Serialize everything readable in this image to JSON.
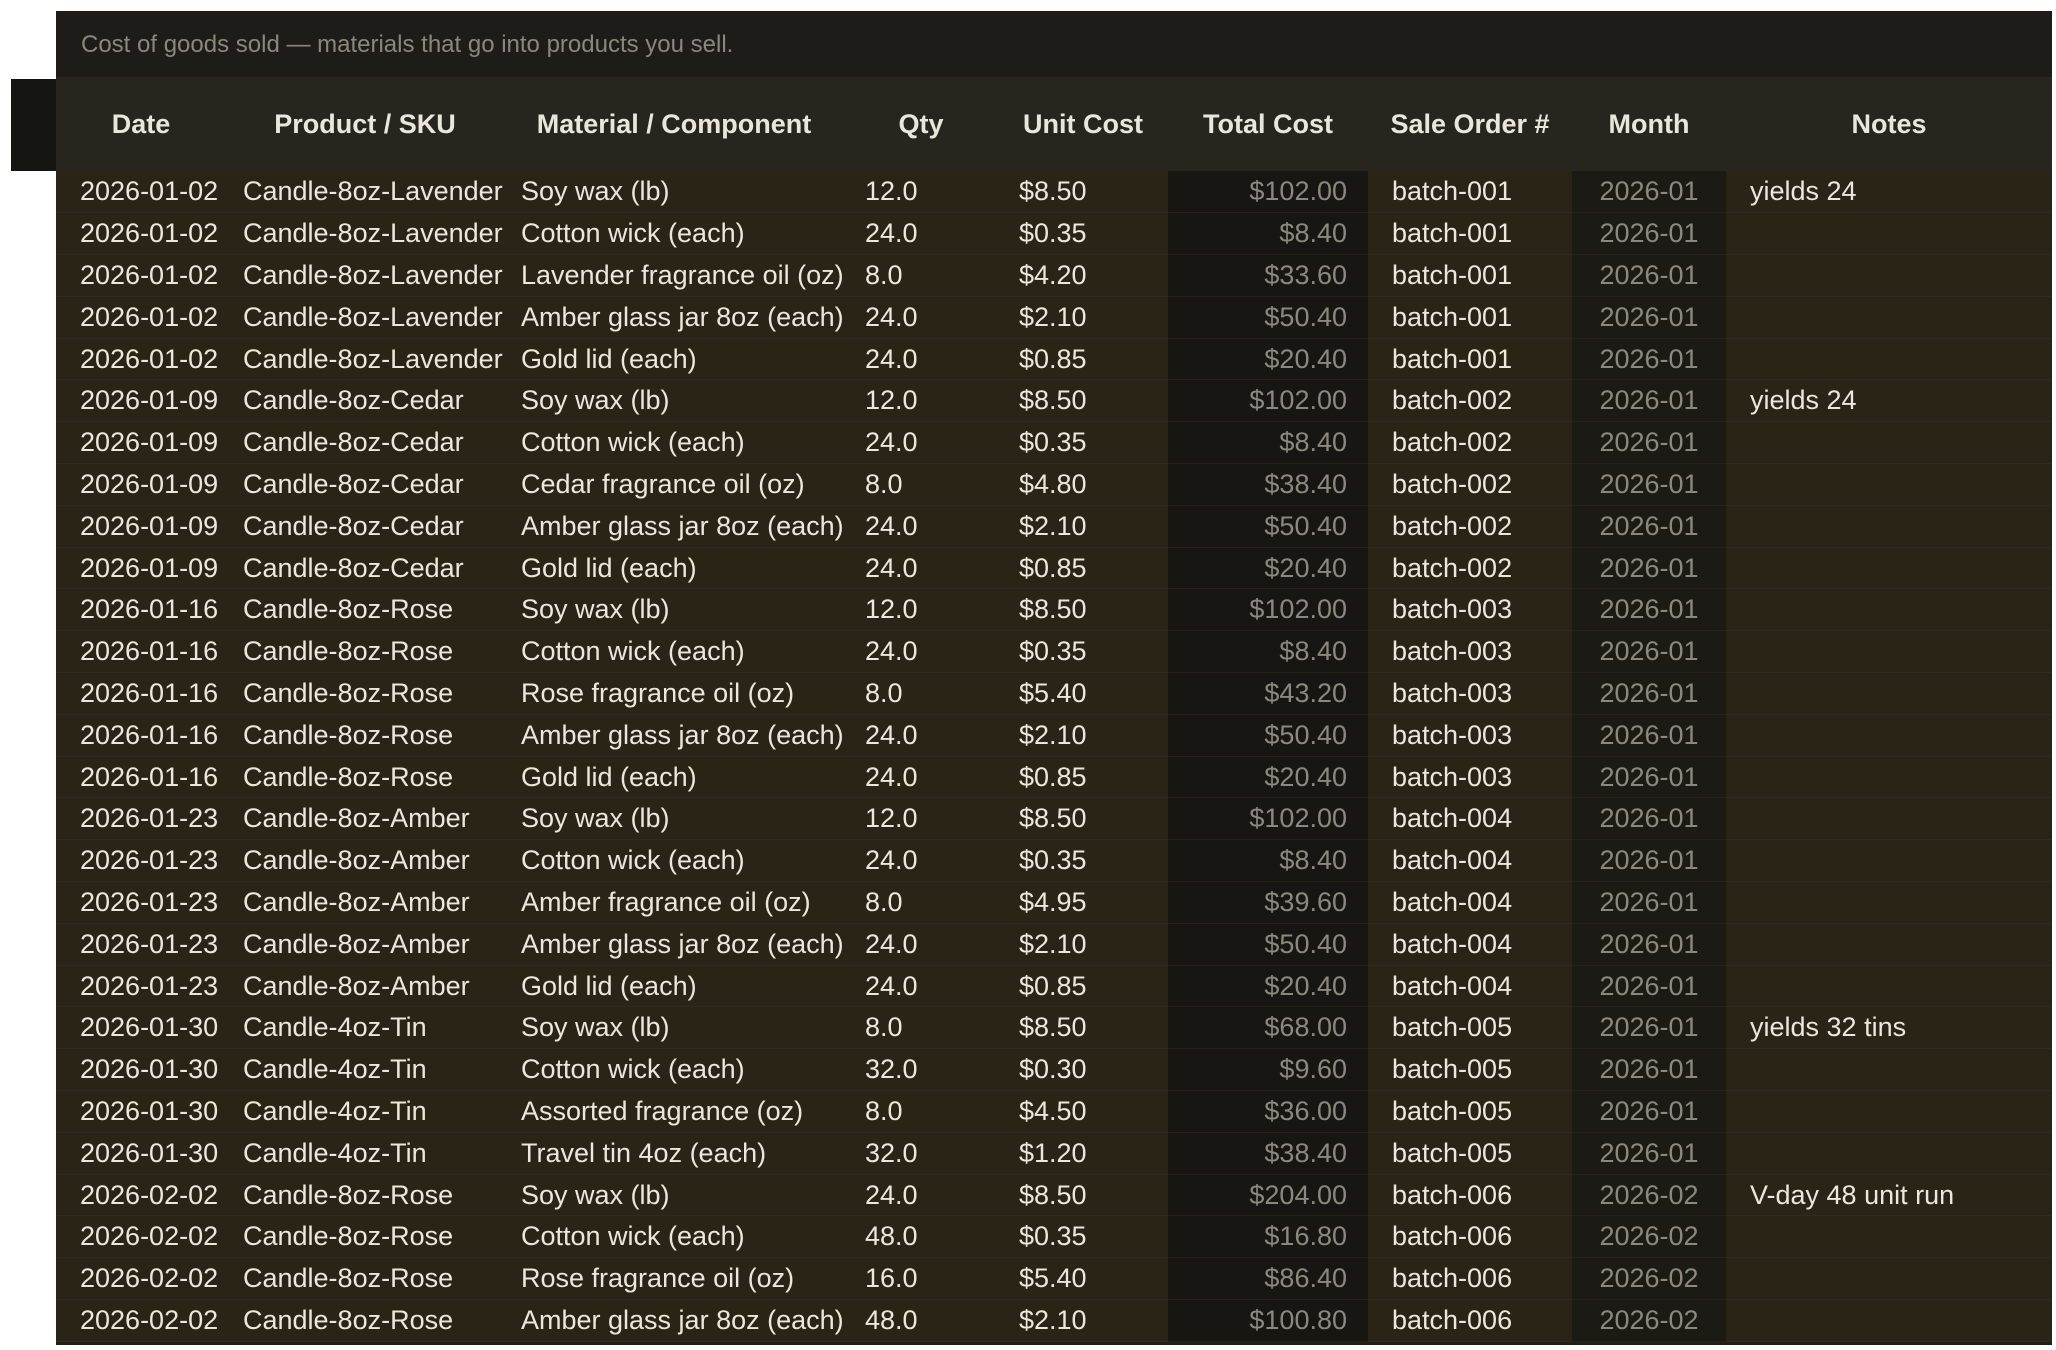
{
  "banner_text": "Cost of goods sold — materials that go into products you sell.",
  "columns": [
    "Date",
    "Product / SKU",
    "Material / Component",
    "Qty",
    "Unit Cost",
    "Total Cost",
    "Sale Order #",
    "Month",
    "Notes"
  ],
  "rows": [
    {
      "date": "2026-01-02",
      "product": "Candle-8oz-Lavender",
      "material": "Soy wax (lb)",
      "qty": "12.0",
      "unit_cost": "$8.50",
      "total_cost": "$102.00",
      "order": "batch-001",
      "month": "2026-01",
      "notes": "yields 24"
    },
    {
      "date": "2026-01-02",
      "product": "Candle-8oz-Lavender",
      "material": "Cotton wick (each)",
      "qty": "24.0",
      "unit_cost": "$0.35",
      "total_cost": "$8.40",
      "order": "batch-001",
      "month": "2026-01",
      "notes": ""
    },
    {
      "date": "2026-01-02",
      "product": "Candle-8oz-Lavender",
      "material": "Lavender fragrance oil (oz)",
      "qty": "8.0",
      "unit_cost": "$4.20",
      "total_cost": "$33.60",
      "order": "batch-001",
      "month": "2026-01",
      "notes": ""
    },
    {
      "date": "2026-01-02",
      "product": "Candle-8oz-Lavender",
      "material": "Amber glass jar 8oz (each)",
      "qty": "24.0",
      "unit_cost": "$2.10",
      "total_cost": "$50.40",
      "order": "batch-001",
      "month": "2026-01",
      "notes": ""
    },
    {
      "date": "2026-01-02",
      "product": "Candle-8oz-Lavender",
      "material": "Gold lid (each)",
      "qty": "24.0",
      "unit_cost": "$0.85",
      "total_cost": "$20.40",
      "order": "batch-001",
      "month": "2026-01",
      "notes": ""
    },
    {
      "date": "2026-01-09",
      "product": "Candle-8oz-Cedar",
      "material": "Soy wax (lb)",
      "qty": "12.0",
      "unit_cost": "$8.50",
      "total_cost": "$102.00",
      "order": "batch-002",
      "month": "2026-01",
      "notes": "yields 24"
    },
    {
      "date": "2026-01-09",
      "product": "Candle-8oz-Cedar",
      "material": "Cotton wick (each)",
      "qty": "24.0",
      "unit_cost": "$0.35",
      "total_cost": "$8.40",
      "order": "batch-002",
      "month": "2026-01",
      "notes": ""
    },
    {
      "date": "2026-01-09",
      "product": "Candle-8oz-Cedar",
      "material": "Cedar fragrance oil (oz)",
      "qty": "8.0",
      "unit_cost": "$4.80",
      "total_cost": "$38.40",
      "order": "batch-002",
      "month": "2026-01",
      "notes": ""
    },
    {
      "date": "2026-01-09",
      "product": "Candle-8oz-Cedar",
      "material": "Amber glass jar 8oz (each)",
      "qty": "24.0",
      "unit_cost": "$2.10",
      "total_cost": "$50.40",
      "order": "batch-002",
      "month": "2026-01",
      "notes": ""
    },
    {
      "date": "2026-01-09",
      "product": "Candle-8oz-Cedar",
      "material": "Gold lid (each)",
      "qty": "24.0",
      "unit_cost": "$0.85",
      "total_cost": "$20.40",
      "order": "batch-002",
      "month": "2026-01",
      "notes": ""
    },
    {
      "date": "2026-01-16",
      "product": "Candle-8oz-Rose",
      "material": "Soy wax (lb)",
      "qty": "12.0",
      "unit_cost": "$8.50",
      "total_cost": "$102.00",
      "order": "batch-003",
      "month": "2026-01",
      "notes": ""
    },
    {
      "date": "2026-01-16",
      "product": "Candle-8oz-Rose",
      "material": "Cotton wick (each)",
      "qty": "24.0",
      "unit_cost": "$0.35",
      "total_cost": "$8.40",
      "order": "batch-003",
      "month": "2026-01",
      "notes": ""
    },
    {
      "date": "2026-01-16",
      "product": "Candle-8oz-Rose",
      "material": "Rose fragrance oil (oz)",
      "qty": "8.0",
      "unit_cost": "$5.40",
      "total_cost": "$43.20",
      "order": "batch-003",
      "month": "2026-01",
      "notes": ""
    },
    {
      "date": "2026-01-16",
      "product": "Candle-8oz-Rose",
      "material": "Amber glass jar 8oz (each)",
      "qty": "24.0",
      "unit_cost": "$2.10",
      "total_cost": "$50.40",
      "order": "batch-003",
      "month": "2026-01",
      "notes": ""
    },
    {
      "date": "2026-01-16",
      "product": "Candle-8oz-Rose",
      "material": "Gold lid (each)",
      "qty": "24.0",
      "unit_cost": "$0.85",
      "total_cost": "$20.40",
      "order": "batch-003",
      "month": "2026-01",
      "notes": ""
    },
    {
      "date": "2026-01-23",
      "product": "Candle-8oz-Amber",
      "material": "Soy wax (lb)",
      "qty": "12.0",
      "unit_cost": "$8.50",
      "total_cost": "$102.00",
      "order": "batch-004",
      "month": "2026-01",
      "notes": ""
    },
    {
      "date": "2026-01-23",
      "product": "Candle-8oz-Amber",
      "material": "Cotton wick (each)",
      "qty": "24.0",
      "unit_cost": "$0.35",
      "total_cost": "$8.40",
      "order": "batch-004",
      "month": "2026-01",
      "notes": ""
    },
    {
      "date": "2026-01-23",
      "product": "Candle-8oz-Amber",
      "material": "Amber fragrance oil (oz)",
      "qty": "8.0",
      "unit_cost": "$4.95",
      "total_cost": "$39.60",
      "order": "batch-004",
      "month": "2026-01",
      "notes": ""
    },
    {
      "date": "2026-01-23",
      "product": "Candle-8oz-Amber",
      "material": "Amber glass jar 8oz (each)",
      "qty": "24.0",
      "unit_cost": "$2.10",
      "total_cost": "$50.40",
      "order": "batch-004",
      "month": "2026-01",
      "notes": ""
    },
    {
      "date": "2026-01-23",
      "product": "Candle-8oz-Amber",
      "material": "Gold lid (each)",
      "qty": "24.0",
      "unit_cost": "$0.85",
      "total_cost": "$20.40",
      "order": "batch-004",
      "month": "2026-01",
      "notes": ""
    },
    {
      "date": "2026-01-30",
      "product": "Candle-4oz-Tin",
      "material": "Soy wax (lb)",
      "qty": "8.0",
      "unit_cost": "$8.50",
      "total_cost": "$68.00",
      "order": "batch-005",
      "month": "2026-01",
      "notes": "yields 32 tins"
    },
    {
      "date": "2026-01-30",
      "product": "Candle-4oz-Tin",
      "material": "Cotton wick (each)",
      "qty": "32.0",
      "unit_cost": "$0.30",
      "total_cost": "$9.60",
      "order": "batch-005",
      "month": "2026-01",
      "notes": ""
    },
    {
      "date": "2026-01-30",
      "product": "Candle-4oz-Tin",
      "material": "Assorted fragrance (oz)",
      "qty": "8.0",
      "unit_cost": "$4.50",
      "total_cost": "$36.00",
      "order": "batch-005",
      "month": "2026-01",
      "notes": ""
    },
    {
      "date": "2026-01-30",
      "product": "Candle-4oz-Tin",
      "material": "Travel tin 4oz (each)",
      "qty": "32.0",
      "unit_cost": "$1.20",
      "total_cost": "$38.40",
      "order": "batch-005",
      "month": "2026-01",
      "notes": ""
    },
    {
      "date": "2026-02-02",
      "product": "Candle-8oz-Rose",
      "material": "Soy wax (lb)",
      "qty": "24.0",
      "unit_cost": "$8.50",
      "total_cost": "$204.00",
      "order": "batch-006",
      "month": "2026-02",
      "notes": "V-day 48 unit run"
    },
    {
      "date": "2026-02-02",
      "product": "Candle-8oz-Rose",
      "material": "Cotton wick (each)",
      "qty": "48.0",
      "unit_cost": "$0.35",
      "total_cost": "$16.80",
      "order": "batch-006",
      "month": "2026-02",
      "notes": ""
    },
    {
      "date": "2026-02-02",
      "product": "Candle-8oz-Rose",
      "material": "Rose fragrance oil (oz)",
      "qty": "16.0",
      "unit_cost": "$5.40",
      "total_cost": "$86.40",
      "order": "batch-006",
      "month": "2026-02",
      "notes": ""
    },
    {
      "date": "2026-02-02",
      "product": "Candle-8oz-Rose",
      "material": "Amber glass jar 8oz (each)",
      "qty": "48.0",
      "unit_cost": "$2.10",
      "total_cost": "$100.80",
      "order": "batch-006",
      "month": "2026-02",
      "notes": ""
    }
  ]
}
